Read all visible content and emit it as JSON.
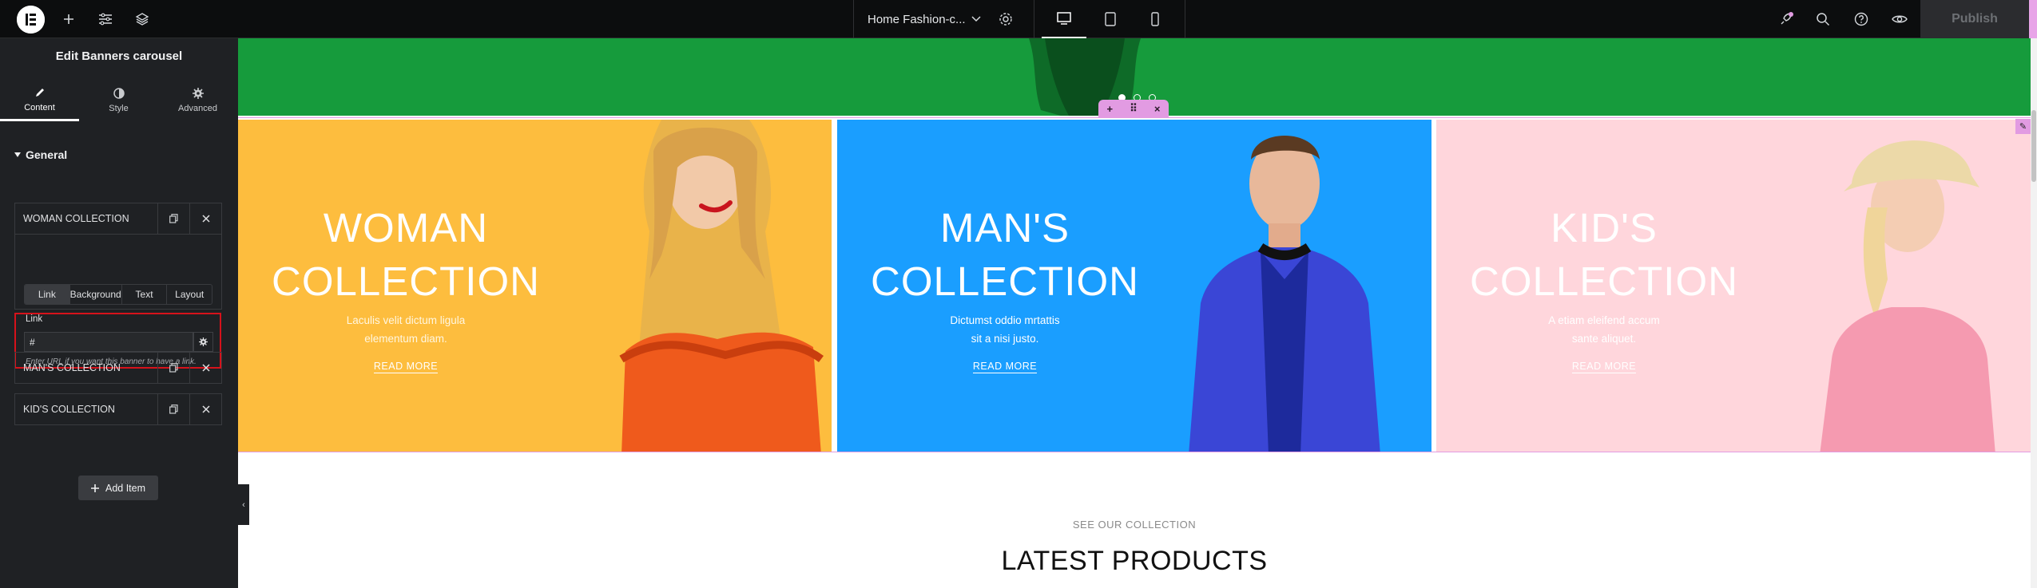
{
  "topbar": {
    "page_name": "Home Fashion-c...",
    "publish_label": "Publish"
  },
  "panel": {
    "title": "Edit Banners carousel",
    "tabs": [
      {
        "label": "Content",
        "icon": "pencil-icon"
      },
      {
        "label": "Style",
        "icon": "half-circle-icon"
      },
      {
        "label": "Advanced",
        "icon": "gear-icon"
      }
    ],
    "section_title": "General",
    "items": [
      {
        "title": "WOMAN COLLECTION"
      },
      {
        "title": "MAN'S COLLECTION"
      },
      {
        "title": "KID'S COLLECTION"
      }
    ],
    "subtabs": [
      "Link",
      "Background",
      "Text",
      "Layout"
    ],
    "link_label": "Link",
    "link_value": "#",
    "link_help": "Enter URL if you want this banner to have a link.",
    "add_item_label": "Add Item"
  },
  "banners": [
    {
      "title_line1": "WOMAN",
      "title_line2": "COLLECTION",
      "desc_line1": "Laculis velit dictum ligula",
      "desc_line2": "elementum diam.",
      "link": "READ MORE",
      "bg": "#fdbd3e"
    },
    {
      "title_line1": "MAN'S",
      "title_line2": "COLLECTION",
      "desc_line1": "Dictumst oddio mrtattis",
      "desc_line2": "sit a nisi justo.",
      "link": "READ MORE",
      "bg": "#1a9eff"
    },
    {
      "title_line1": "KID'S",
      "title_line2": "COLLECTION",
      "desc_line1": "A etiam eleifend accum",
      "desc_line2": "sante aliquet.",
      "link": "READ MORE",
      "bg": "#ffd6dc"
    }
  ],
  "content": {
    "subheading": "SEE OUR COLLECTION",
    "heading": "LATEST PRODUCTS"
  },
  "colors": {
    "accent_pink": "#e29be2",
    "highlight_red": "#d6121b",
    "green_section": "#169b3c"
  }
}
